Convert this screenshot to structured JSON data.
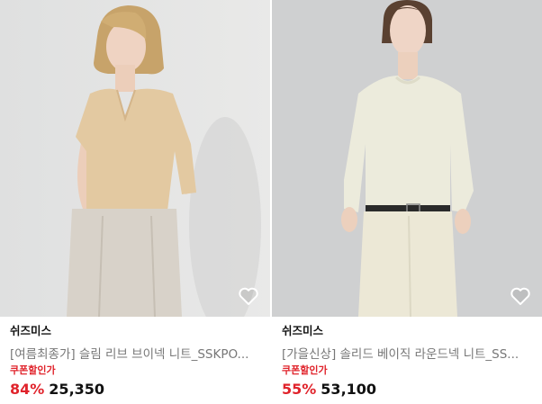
{
  "products": [
    {
      "brand": "쉬즈미스",
      "title": "[여름최종가] 슬림 리브 브이넥 니트_SSKPO...",
      "coupon_label": "쿠폰할인가",
      "discount": "84%",
      "price": "25,350",
      "image_icon": "product-photo-beige-vneck-knit",
      "wishlist_icon": "heart-outline-icon"
    },
    {
      "brand": "쉬즈미스",
      "title": "[가을신상] 솔리드 베이직 라운드넥 니트_SS...",
      "coupon_label": "쿠폰할인가",
      "discount": "55%",
      "price": "53,100",
      "image_icon": "product-photo-ivory-roundneck-knit",
      "wishlist_icon": "heart-outline-icon"
    }
  ],
  "colors": {
    "discount": "#e0232b",
    "coupon": "#e0232b",
    "title": "#777777",
    "brand": "#111111"
  }
}
